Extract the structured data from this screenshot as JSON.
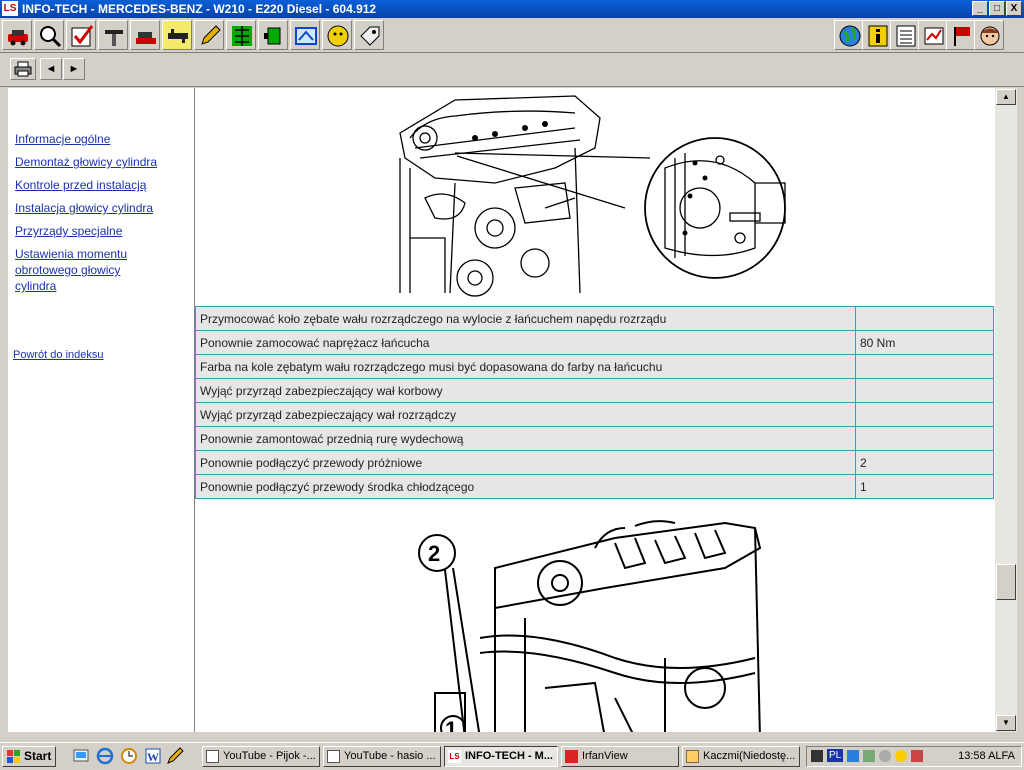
{
  "window": {
    "title": "INFO-TECH - MERCEDES-BENZ - W210 - E220 Diesel - 604.912",
    "logo": "LS",
    "min": "_",
    "max": "□",
    "close": "X"
  },
  "toolbar": {
    "icons": [
      "car-icon",
      "magnifier-icon",
      "checkbox-icon",
      "wrench-hand-icon",
      "car-lift-icon",
      "tool-icon",
      "pencil-icon",
      "circuit-icon",
      "plug-icon",
      "dashboard-icon",
      "globe-head-icon",
      "tag-icon"
    ],
    "right_icons": [
      "globe-icon",
      "info-icon",
      "list-icon",
      "gear-chart-icon",
      "flag-person-icon",
      "user-face-icon"
    ]
  },
  "subtoolbar": {
    "print_icon": "printer-icon",
    "back": "◄",
    "forward": "►"
  },
  "nav": {
    "items": [
      "Informacje ogólne",
      "Demontaż głowicy cylindra",
      "Kontrole przed instalacją",
      "Instalacja głowicy cylindra",
      "Przyrządy specjalne",
      "Ustawienia momentu obrotowego głowicy cylindra"
    ],
    "back_link": "Powrót do indeksu"
  },
  "steps": [
    {
      "text": "Przymocować koło zębate wału rozrządczego na wylocie z łańcuchem napędu rozrządu",
      "value": ""
    },
    {
      "text": "Ponownie zamocować naprężacz łańcucha",
      "value": "80 Nm"
    },
    {
      "text": "Farba na kole zębatym wału rozrządczego musi być dopasowana do farby na łańcuchu",
      "value": ""
    },
    {
      "text": "Wyjąć przyrząd zabezpieczający wał korbowy",
      "value": ""
    },
    {
      "text": "Wyjąć przyrząd zabezpieczający wał rozrządczy",
      "value": ""
    },
    {
      "text": "Ponownie zamontować przednią rurę wydechową",
      "value": ""
    },
    {
      "text": "Ponownie podłączyć przewody próżniowe",
      "value": "2"
    },
    {
      "text": "Ponownie podłączyć przewody środka chłodzącego",
      "value": "1"
    }
  ],
  "diagram": {
    "callout_top": "2",
    "callout_bottom": "1"
  },
  "taskbar": {
    "start": "Start",
    "tasks": [
      {
        "label": "YouTube - Pijok -..."
      },
      {
        "label": "YouTube - hasio ..."
      },
      {
        "label": "INFO-TECH - M..."
      },
      {
        "label": "IrfanView"
      },
      {
        "label": "Kaczmi(Niedostę..."
      }
    ],
    "tray_lang": "PL",
    "clock": "13:58 ALFA"
  }
}
